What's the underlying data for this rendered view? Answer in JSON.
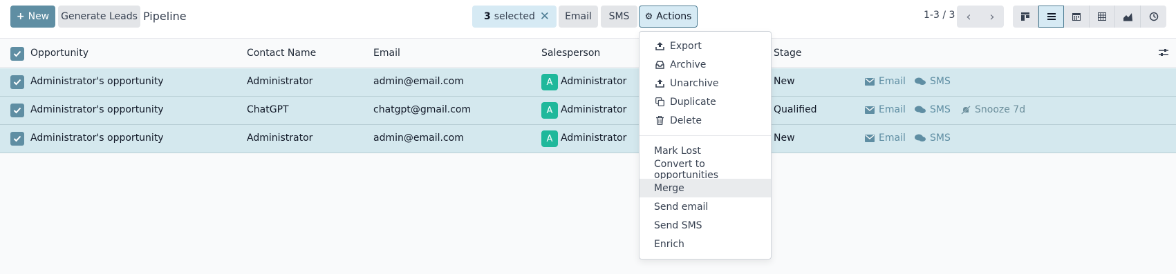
{
  "control_panel": {
    "new_label": "New",
    "generate_leads_label": "Generate Leads",
    "title": "Pipeline",
    "selection": {
      "count": "3",
      "label": "selected"
    },
    "email_label": "Email",
    "sms_label": "SMS",
    "actions_label": "Actions",
    "pager": "1-3 / 3"
  },
  "views": [
    "kanban-view-icon",
    "list-view-icon",
    "calendar-view-icon",
    "pivot-view-icon",
    "graph-view-icon",
    "activity-view-icon"
  ],
  "table": {
    "headers": {
      "opportunity": "Opportunity",
      "contact_name": "Contact Name",
      "email": "Email",
      "salesperson": "Salesperson",
      "stage": "Stage"
    },
    "rows": [
      {
        "opportunity": "Administrator's opportunity",
        "contact_name": "Administrator",
        "email": "admin@email.com",
        "avatar": "A",
        "salesperson": "Administrator",
        "stage": "New",
        "email_action": "Email",
        "sms_action": "SMS"
      },
      {
        "opportunity": "Administrator's opportunity",
        "contact_name": "ChatGPT",
        "email": "chatgpt@gmail.com",
        "avatar": "A",
        "salesperson": "Administrator",
        "stage": "Qualified",
        "email_action": "Email",
        "sms_action": "SMS",
        "snooze_action": "Snooze 7d"
      },
      {
        "opportunity": "Administrator's opportunity",
        "contact_name": "Administrator",
        "email": "admin@email.com",
        "avatar": "A",
        "salesperson": "Administrator",
        "stage": "New",
        "email_action": "Email",
        "sms_action": "SMS"
      }
    ]
  },
  "actions_menu": {
    "items_with_icons": [
      {
        "label": "Export",
        "icon": "upload-icon"
      },
      {
        "label": "Archive",
        "icon": "inbox-icon"
      },
      {
        "label": "Unarchive",
        "icon": "upload-icon"
      },
      {
        "label": "Duplicate",
        "icon": "copy-icon"
      },
      {
        "label": "Delete",
        "icon": "trash-icon"
      }
    ],
    "items": [
      "Mark Lost",
      "Convert to opportunities",
      "Merge",
      "Send email",
      "Send SMS",
      "Enrich"
    ],
    "highlighted": "Merge"
  },
  "colors": {
    "primary": "#5f8ea3",
    "selected_row": "#d4e8ee",
    "avatar": "#1fb89b"
  }
}
